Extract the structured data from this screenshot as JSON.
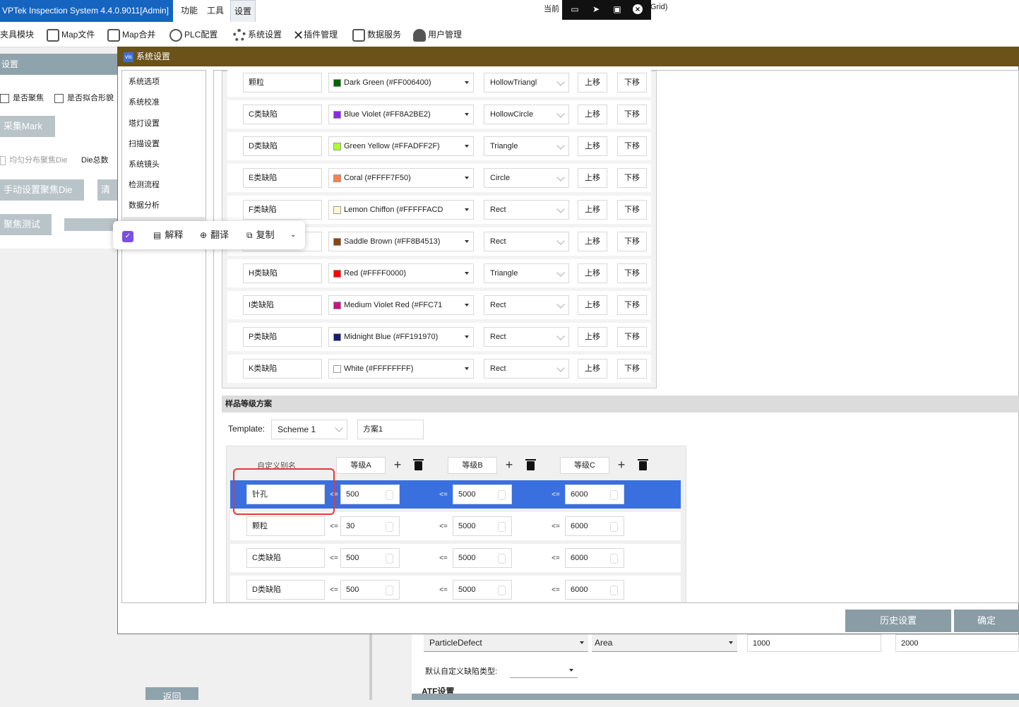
{
  "titlebar": {
    "app_title": "VPTek Inspection System 4.4.0.9011[Admin]",
    "menus": [
      "功能",
      "工具",
      "设置"
    ],
    "current_label": "当前",
    "grid_text": "Grid)"
  },
  "toolbar": [
    "夹具模块",
    "Map文件",
    "Map合并",
    "PLC配置",
    "系统设置",
    "插件管理",
    "数据服务",
    "用户管理"
  ],
  "left_panel": {
    "header": "设置",
    "check_focus": "是否聚焦",
    "check_fit": "是否拟合形貌",
    "collect_mark": "采集Mark",
    "uniform_die": "均匀分布聚焦Die",
    "die_total": "Die总数",
    "manual_die": "手动设置聚焦Die",
    "clear_partial": "清",
    "focus_test": "聚焦测试",
    "back_button": "返回"
  },
  "dialog": {
    "title": "系统设置",
    "nav": [
      "系统选项",
      "系统校准",
      "塔灯设置",
      "扫描设置",
      "系统镜头",
      "检测流程",
      "数据分析"
    ],
    "up_label": "上移",
    "down_label": "下移",
    "defects": [
      {
        "name": "颗粒",
        "color_label": "Dark Green (#FF006400)",
        "color": "#006400",
        "shape": "HollowTriangl"
      },
      {
        "name": "C类缺陷",
        "color_label": "Blue Violet (#FF8A2BE2)",
        "color": "#8A2BE2",
        "shape": "HollowCircle"
      },
      {
        "name": "D类缺陷",
        "color_label": "Green Yellow (#FFADFF2F)",
        "color": "#ADFF2F",
        "shape": "Triangle"
      },
      {
        "name": "E类缺陷",
        "color_label": "Coral (#FFFF7F50)",
        "color": "#FF7F50",
        "shape": "Circle"
      },
      {
        "name": "F类缺陷",
        "color_label": "Lemon Chiffon (#FFFFFACD",
        "color": "#FFFACD",
        "shape": "Rect"
      },
      {
        "name": "",
        "color_label": "Saddle Brown (#FF8B4513)",
        "color": "#8B4513",
        "shape": "Rect"
      },
      {
        "name": "H类缺陷",
        "color_label": "Red (#FFFF0000)",
        "color": "#FF0000",
        "shape": "Triangle"
      },
      {
        "name": "I类缺陷",
        "color_label": "Medium Violet Red (#FFC71",
        "color": "#C71585",
        "shape": "Rect"
      },
      {
        "name": "P类缺陷",
        "color_label": "Midnight Blue (#FF191970)",
        "color": "#191970",
        "shape": "Rect"
      },
      {
        "name": "K类缺陷",
        "color_label": "White (#FFFFFFFF)",
        "color": "#FFFFFF",
        "shape": "Rect"
      }
    ],
    "grade_section": {
      "title": "样品等级方案",
      "template_label": "Template:",
      "template_value": "Scheme 1",
      "scheme_name": "方案1",
      "alias_header": "自定义别名",
      "grades": [
        "等级A",
        "等级B",
        "等级C"
      ],
      "le_symbol": "<=",
      "rows": [
        {
          "alias": "针孔",
          "a": "500",
          "b": "5000",
          "c": "6000",
          "selected": true
        },
        {
          "alias": "颗粒",
          "a": "30",
          "b": "5000",
          "c": "6000",
          "selected": false
        },
        {
          "alias": "C类缺陷",
          "a": "500",
          "b": "5000",
          "c": "6000",
          "selected": false
        },
        {
          "alias": "D类缺陷",
          "a": "500",
          "b": "5000",
          "c": "6000",
          "selected": false
        }
      ]
    },
    "history_button": "历史设置",
    "ok_button": "确定"
  },
  "popup": {
    "explain": "解释",
    "translate": "翻译",
    "copy": "复制"
  },
  "bottom": {
    "defect_type": "ParticleDefect",
    "metric": "Area",
    "val1": "1000",
    "val2": "2000",
    "default_custom_label": "默认自定义缺陷类型:",
    "atf_label": "ATF设置"
  }
}
